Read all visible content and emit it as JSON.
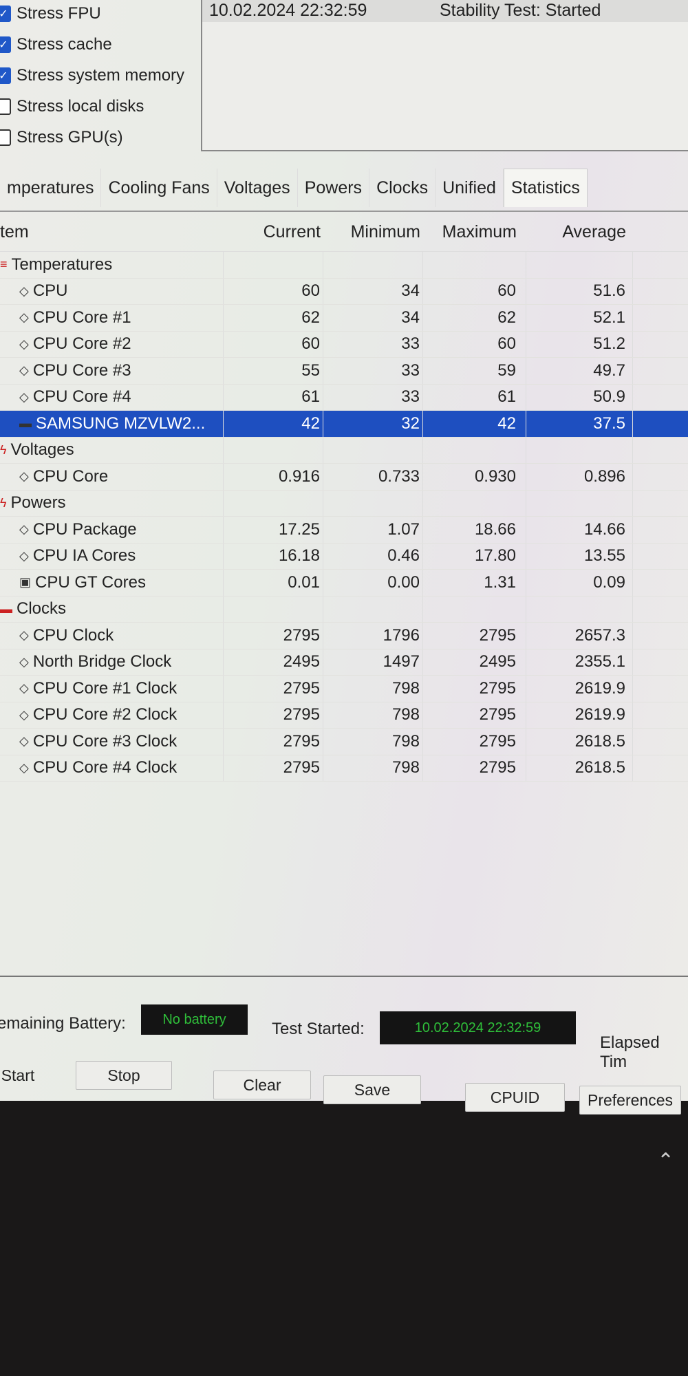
{
  "options": [
    {
      "label": "Stress FPU",
      "checked": true
    },
    {
      "label": "Stress cache",
      "checked": true
    },
    {
      "label": "Stress system memory",
      "checked": true
    },
    {
      "label": "Stress local disks",
      "checked": false
    },
    {
      "label": "Stress GPU(s)",
      "checked": false
    }
  ],
  "log": {
    "date": "10.02.2024 22:32:59",
    "status": "Stability Test: Started"
  },
  "tabs": [
    "mperatures",
    "Cooling Fans",
    "Voltages",
    "Powers",
    "Clocks",
    "Unified",
    "Statistics"
  ],
  "active_tab": "Statistics",
  "columns": [
    "tem",
    "Current",
    "Minimum",
    "Maximum",
    "Average"
  ],
  "rows": [
    {
      "group": true,
      "icon": "thermometer-icon",
      "name": "Temperatures"
    },
    {
      "icon": "chip-icon",
      "name": "CPU",
      "v": [
        "60",
        "34",
        "60",
        "51.6"
      ]
    },
    {
      "icon": "chip-icon",
      "name": "CPU Core #1",
      "v": [
        "62",
        "34",
        "62",
        "52.1"
      ]
    },
    {
      "icon": "chip-icon",
      "name": "CPU Core #2",
      "v": [
        "60",
        "33",
        "60",
        "51.2"
      ]
    },
    {
      "icon": "chip-icon",
      "name": "CPU Core #3",
      "v": [
        "55",
        "33",
        "59",
        "49.7"
      ]
    },
    {
      "icon": "chip-icon",
      "name": "CPU Core #4",
      "v": [
        "61",
        "33",
        "61",
        "50.9"
      ]
    },
    {
      "icon": "disk-icon",
      "name": "SAMSUNG MZVLW2...",
      "v": [
        "42",
        "32",
        "42",
        "37.5"
      ],
      "selected": true
    },
    {
      "group": true,
      "icon": "voltage-icon",
      "name": "Voltages"
    },
    {
      "icon": "chip-icon",
      "name": "CPU Core",
      "v": [
        "0.916",
        "0.733",
        "0.930",
        "0.896"
      ]
    },
    {
      "group": true,
      "icon": "power-icon",
      "name": "Powers"
    },
    {
      "icon": "chip-icon",
      "name": "CPU Package",
      "v": [
        "17.25",
        "1.07",
        "18.66",
        "14.66"
      ]
    },
    {
      "icon": "chip-icon",
      "name": "CPU IA Cores",
      "v": [
        "16.18",
        "0.46",
        "17.80",
        "13.55"
      ]
    },
    {
      "icon": "gpu-icon",
      "name": "CPU GT Cores",
      "v": [
        "0.01",
        "0.00",
        "1.31",
        "0.09"
      ]
    },
    {
      "group": true,
      "icon": "clock-icon",
      "name": "Clocks"
    },
    {
      "icon": "chip-icon",
      "name": "CPU Clock",
      "v": [
        "2795",
        "1796",
        "2795",
        "2657.3"
      ]
    },
    {
      "icon": "chip-icon",
      "name": "North Bridge Clock",
      "v": [
        "2495",
        "1497",
        "2495",
        "2355.1"
      ]
    },
    {
      "icon": "chip-icon",
      "name": "CPU Core #1 Clock",
      "v": [
        "2795",
        "798",
        "2795",
        "2619.9"
      ]
    },
    {
      "icon": "chip-icon",
      "name": "CPU Core #2 Clock",
      "v": [
        "2795",
        "798",
        "2795",
        "2619.9"
      ]
    },
    {
      "icon": "chip-icon",
      "name": "CPU Core #3 Clock",
      "v": [
        "2795",
        "798",
        "2795",
        "2618.5"
      ]
    },
    {
      "icon": "chip-icon",
      "name": "CPU Core #4 Clock",
      "v": [
        "2795",
        "798",
        "2795",
        "2618.5"
      ]
    }
  ],
  "status": {
    "battery_label": "emaining Battery:",
    "battery_value": "No battery",
    "started_label": "Test Started:",
    "started_value": "10.02.2024 22:32:59",
    "elapsed_label": "Elapsed Tim"
  },
  "buttons": [
    "Start",
    "Stop",
    "Clear",
    "Save",
    "CPUID",
    "Preferences"
  ],
  "colors": {
    "selection": "#1e4fc0",
    "lcd_text": "#2fbf3a",
    "lcd_bg": "#141414"
  }
}
